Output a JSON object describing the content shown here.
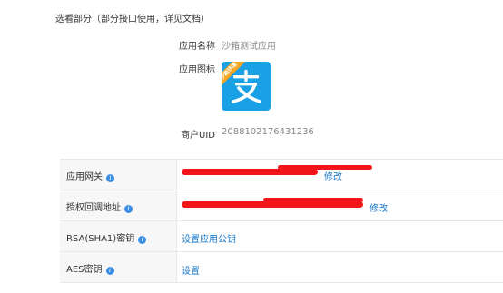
{
  "section": {
    "title": "选看部分（部分接口使用，详见文档）"
  },
  "app_info": {
    "name_label": "应用名称",
    "name_value": "沙箱测试应用",
    "icon_label": "应用图标",
    "icon_ribbon": "沙箱环境",
    "merchant_label": "商户UID",
    "merchant_value": "2088102176431236"
  },
  "settings": {
    "rows": [
      {
        "label": "应用网关",
        "action": "修改",
        "value_redacted": true
      },
      {
        "label": "授权回调地址",
        "action": "修改",
        "value_redacted": true
      },
      {
        "label": "RSA(SHA1)密钥",
        "action": "设置应用公钥"
      },
      {
        "label": "AES密钥",
        "action": "设置"
      }
    ]
  },
  "colors": {
    "link": "#1677c8",
    "info_icon": "#3a8ee6",
    "app_icon_bg": "#1aa0e4",
    "redaction": "#f2161b"
  },
  "icons": {
    "info": "info-circle-icon",
    "app": "alipay-icon"
  }
}
